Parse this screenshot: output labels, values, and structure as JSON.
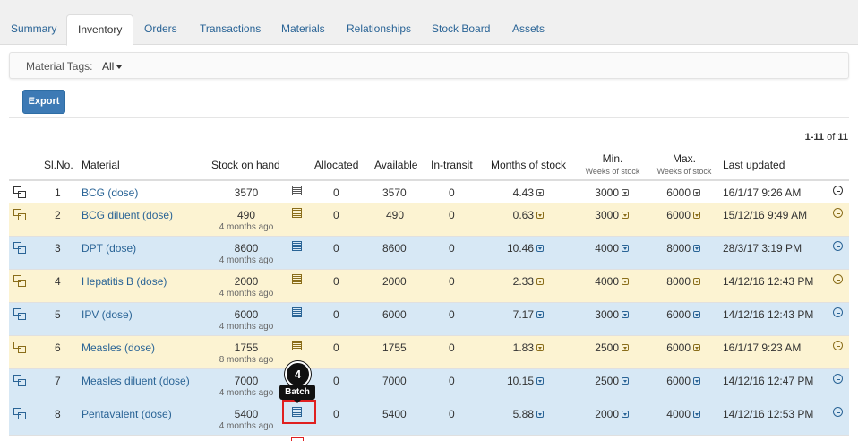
{
  "tabs": [
    {
      "label": "Summary"
    },
    {
      "label": "Inventory"
    },
    {
      "label": "Orders"
    },
    {
      "label": "Transactions"
    },
    {
      "label": "Materials"
    },
    {
      "label": "Relationships"
    },
    {
      "label": "Stock Board"
    },
    {
      "label": "Assets"
    }
  ],
  "active_tab": "Inventory",
  "filter": {
    "label": "Material Tags:",
    "value": "All"
  },
  "export_label": "Export",
  "pager": {
    "range": "1-11",
    "of": "of",
    "total": "11"
  },
  "columns": {
    "slno": "Sl.No.",
    "material": "Material",
    "stock": "Stock on hand",
    "allocated": "Allocated",
    "available": "Available",
    "intransit": "In-transit",
    "months": "Months of stock",
    "min": "Min.",
    "min_sub": "Weeks of stock",
    "max": "Max.",
    "max_sub": "Weeks of stock",
    "updated": "Last updated"
  },
  "rows": [
    {
      "sl": "1",
      "material": "BCG (dose)",
      "stock": "3570",
      "stock_age": "",
      "allocated": "0",
      "available": "3570",
      "intransit": "0",
      "months": "4.43",
      "min": "3000",
      "max": "6000",
      "updated": "16/1/17 9:26 AM"
    },
    {
      "sl": "2",
      "material": "BCG diluent (dose)",
      "stock": "490",
      "stock_age": "4 months ago",
      "allocated": "0",
      "available": "490",
      "intransit": "0",
      "months": "0.63",
      "min": "3000",
      "max": "6000",
      "updated": "15/12/16 9:49 AM"
    },
    {
      "sl": "3",
      "material": "DPT (dose)",
      "stock": "8600",
      "stock_age": "4 months ago",
      "allocated": "0",
      "available": "8600",
      "intransit": "0",
      "months": "10.46",
      "min": "4000",
      "max": "8000",
      "updated": "28/3/17 3:19 PM"
    },
    {
      "sl": "4",
      "material": "Hepatitis B (dose)",
      "stock": "2000",
      "stock_age": "4 months ago",
      "allocated": "0",
      "available": "2000",
      "intransit": "0",
      "months": "2.33",
      "min": "4000",
      "max": "8000",
      "updated": "14/12/16 12:43 PM"
    },
    {
      "sl": "5",
      "material": "IPV (dose)",
      "stock": "6000",
      "stock_age": "4 months ago",
      "allocated": "0",
      "available": "6000",
      "intransit": "0",
      "months": "7.17",
      "min": "3000",
      "max": "6000",
      "updated": "14/12/16 12:43 PM"
    },
    {
      "sl": "6",
      "material": "Measles (dose)",
      "stock": "1755",
      "stock_age": "8 months ago",
      "allocated": "0",
      "available": "1755",
      "intransit": "0",
      "months": "1.83",
      "min": "2500",
      "max": "6000",
      "updated": "16/1/17 9:23 AM"
    },
    {
      "sl": "7",
      "material": "Measles diluent (dose)",
      "stock": "7000",
      "stock_age": "4 months ago",
      "allocated": "0",
      "available": "7000",
      "intransit": "0",
      "months": "10.15",
      "min": "2500",
      "max": "6000",
      "updated": "14/12/16 12:47 PM"
    },
    {
      "sl": "8",
      "material": "Pentavalent (dose)",
      "stock": "5400",
      "stock_age": "4 months ago",
      "allocated": "0",
      "available": "5400",
      "intransit": "0",
      "months": "5.88",
      "min": "2000",
      "max": "4000",
      "updated": "14/12/16 12:53 PM"
    }
  ],
  "callout": {
    "number": "4",
    "tooltip": "Batch"
  },
  "row_colors": {
    "white": "#ffffff",
    "yellow": "#fcf3d2",
    "blue": "#d7e8f5"
  },
  "accent": "#3d7ab5"
}
